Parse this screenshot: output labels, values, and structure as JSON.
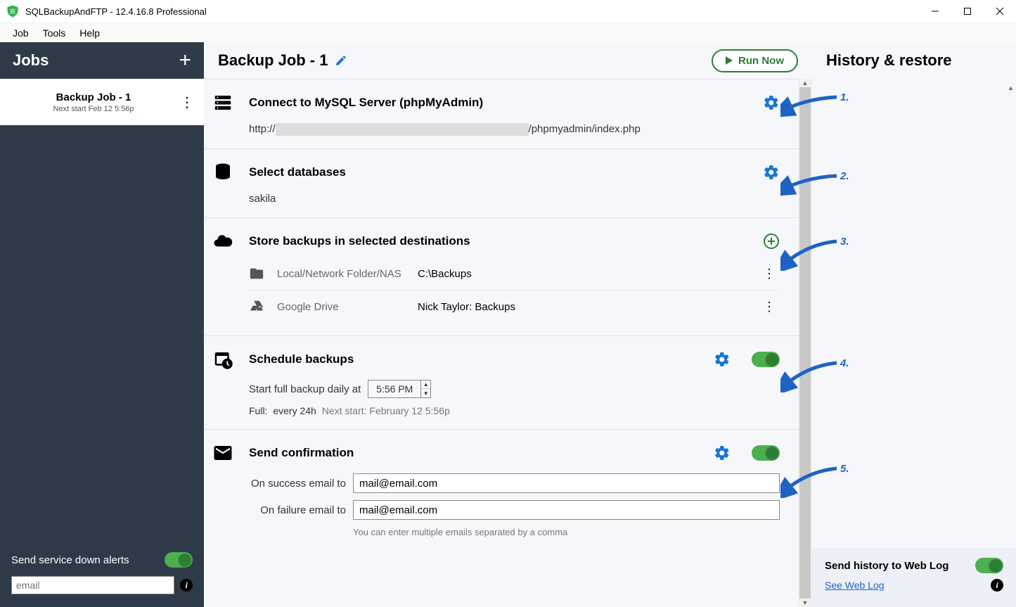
{
  "window": {
    "title": "SQLBackupAndFTP - 12.4.16.8 Professional"
  },
  "menu": {
    "job": "Job",
    "tools": "Tools",
    "help": "Help"
  },
  "sidebar": {
    "header": "Jobs",
    "job": {
      "name": "Backup Job - 1",
      "next": "Next start Feb 12 5:56p"
    },
    "footer": {
      "alerts_label": "Send service down alerts",
      "email_placeholder": "email"
    }
  },
  "content": {
    "title": "Backup Job - 1",
    "run": "Run Now",
    "connect": {
      "title": "Connect to MySQL Server (phpMyAdmin)",
      "url_prefix": "http://",
      "url_suffix": "/phpmyadmin/index.php"
    },
    "selectdb": {
      "title": "Select databases",
      "db": "sakila"
    },
    "dest": {
      "title": "Store backups in selected destinations",
      "rows": [
        {
          "label": "Local/Network Folder/NAS",
          "value": "C:\\Backups"
        },
        {
          "label": "Google Drive",
          "value": "Nick Taylor: Backups"
        }
      ]
    },
    "schedule": {
      "title": "Schedule backups",
      "prefix": "Start full backup daily at",
      "time": "5:56 PM",
      "full_label": "Full:",
      "full_value": "every 24h",
      "next_label": "Next start: February 12 5:56p"
    },
    "confirm": {
      "title": "Send confirmation",
      "success_label": "On success email to",
      "failure_label": "On failure email to",
      "email": "mail@email.com",
      "note": "You can enter multiple emails separated by a comma"
    }
  },
  "right": {
    "title": "History & restore",
    "footer": {
      "label": "Send history to Web Log",
      "link": "See Web Log"
    }
  },
  "annotations": {
    "a1": "1.",
    "a2": "2.",
    "a3": "3.",
    "a4": "4.",
    "a5": "5."
  }
}
